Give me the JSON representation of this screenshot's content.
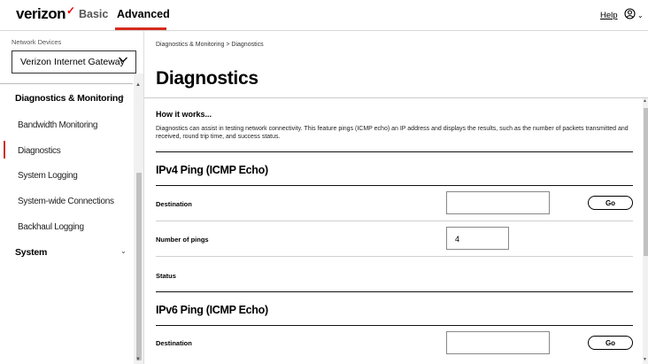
{
  "header": {
    "logo_text": "verizon",
    "logo_mark": "✓",
    "tabs": [
      {
        "label": "Basic"
      },
      {
        "label": "Advanced"
      }
    ],
    "help_label": "Help",
    "user_icon": "user-circle-icon",
    "accent_color": "#d52b1e"
  },
  "sidebar": {
    "network_devices_label": "Network Devices",
    "device_selected": "Verizon Internet Gateway",
    "sections": [
      {
        "label": "Diagnostics & Monitoring",
        "expanded": true,
        "items": [
          {
            "label": "Bandwidth Monitoring"
          },
          {
            "label": "Diagnostics",
            "active": true
          },
          {
            "label": "System Logging"
          },
          {
            "label": "System-wide Connections"
          },
          {
            "label": "Backhaul Logging"
          }
        ]
      },
      {
        "label": "System",
        "expanded": false
      }
    ]
  },
  "main": {
    "breadcrumb": "Diagnostics & Monitoring  >  Diagnostics",
    "title": "Diagnostics",
    "how_title": "How it works...",
    "how_text": "Diagnostics can assist in testing network connectivity. This feature pings (ICMP echo) an IP address and displays the results, such as the number of packets transmitted and received, round trip time, and success status.",
    "ipv4": {
      "title": "IPv4 Ping (ICMP Echo)",
      "destination_label": "Destination",
      "destination_value": "",
      "go_label": "Go",
      "pings_label": "Number of pings",
      "pings_value": "4",
      "status_label": "Status"
    },
    "ipv6": {
      "title": "IPv6 Ping (ICMP Echo)",
      "destination_label": "Destination",
      "destination_value": "",
      "go_label": "Go"
    }
  }
}
